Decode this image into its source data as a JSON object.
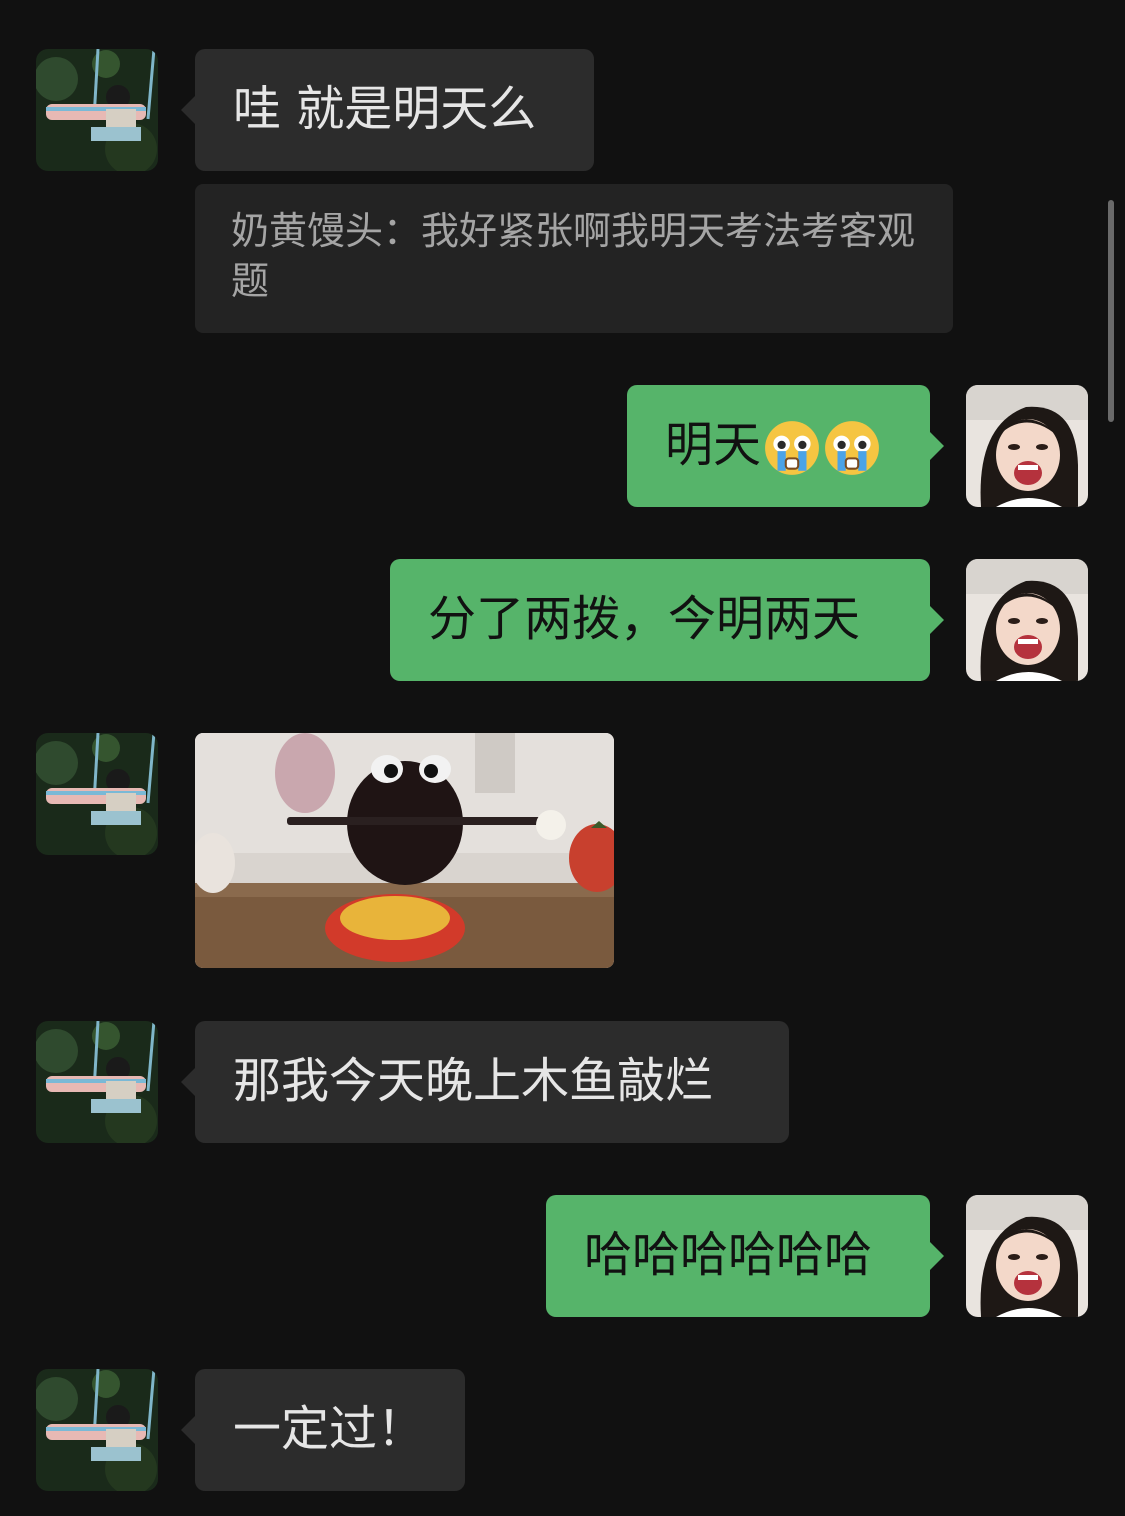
{
  "messages": {
    "m1": {
      "text": "哇 就是明天么"
    },
    "m1_quote": {
      "text": "奶黄馒头：我好紧张啊我明天考法考客观题"
    },
    "m2": {
      "text": "明天",
      "emoji": [
        "crying-face",
        "crying-face"
      ]
    },
    "m3": {
      "text": "分了两拨，今明两天"
    },
    "m4": {
      "image": "wooden-fish-photo"
    },
    "m5": {
      "text": "那我今天晚上木鱼敲烂"
    },
    "m6": {
      "text": "哈哈哈哈哈哈"
    },
    "m7": {
      "text": "一定过！"
    }
  },
  "colors": {
    "background": "#111111",
    "incoming_bubble": "#2c2c2c",
    "outgoing_bubble": "#56b46a",
    "quote_bubble": "#232323"
  }
}
